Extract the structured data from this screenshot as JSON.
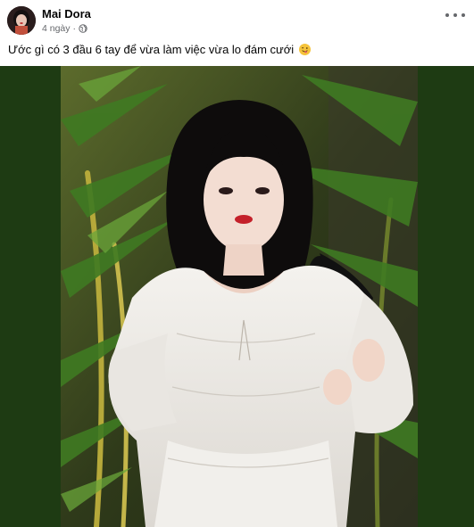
{
  "post": {
    "author": "Mai Dora",
    "time": "4 ngày",
    "separator": "·",
    "privacy_icon": "globe-icon",
    "caption": "Ước gì có 3 đầu 6 tay để vừa làm việc vừa lo đám cưới",
    "caption_emoji": "smiling-face-with-tongue-emoji",
    "menu_icon": "more-options-icon",
    "photo_background": "#1e3b13"
  }
}
